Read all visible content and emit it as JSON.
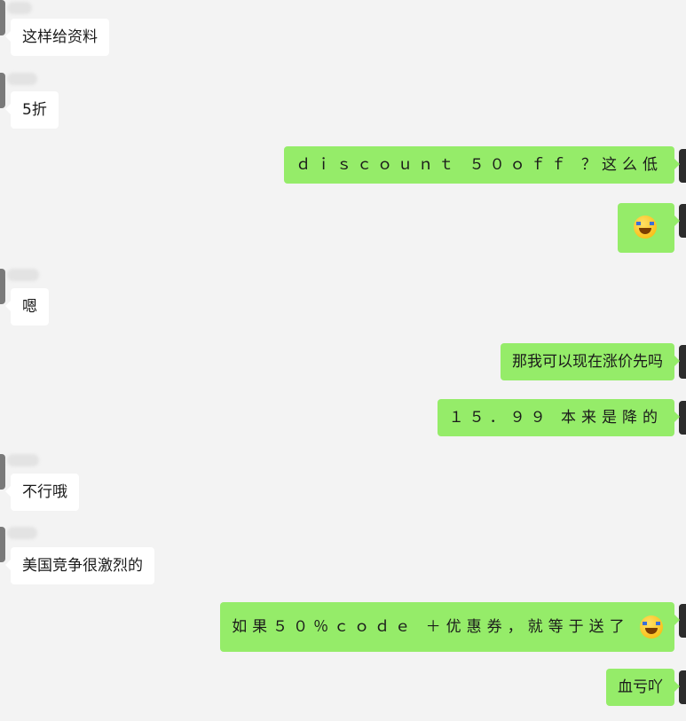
{
  "messages": [
    {
      "from": "them",
      "text": "这样给资料"
    },
    {
      "from": "them",
      "text": "5折"
    },
    {
      "from": "me",
      "text": "ｄｉｓｃｏｕｎｔ ５０ｏｆｆ ？这么低"
    },
    {
      "from": "me",
      "emoji": "rolling-on-floor-laughing"
    },
    {
      "from": "them",
      "text": "嗯"
    },
    {
      "from": "me",
      "text": "那我可以现在涨价先吗"
    },
    {
      "from": "me",
      "text": "１５．９９ 本来是降的"
    },
    {
      "from": "them",
      "text": "不行哦"
    },
    {
      "from": "them",
      "text": "美国竞争很激烈的"
    },
    {
      "from": "me",
      "text": "如果５０％ｃｏｄｅ ＋优惠券，就等于送了",
      "emoji": "rolling-on-floor-laughing"
    },
    {
      "from": "me",
      "text": "血亏吖"
    }
  ],
  "colors": {
    "background": "#f3f3f3",
    "incoming_bubble": "#ffffff",
    "outgoing_bubble": "#95ec69"
  }
}
